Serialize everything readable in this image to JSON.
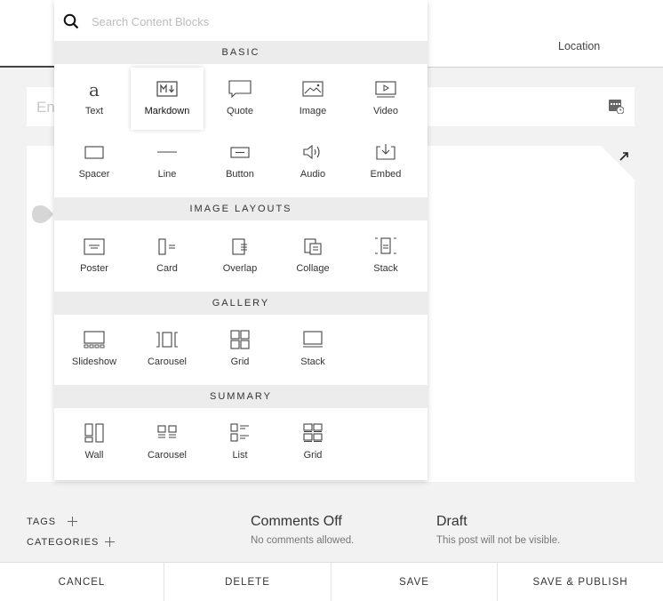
{
  "header": {
    "location_tab": "Location",
    "title_placeholder": "Ent"
  },
  "picker": {
    "search_placeholder": "Search Content Blocks",
    "sections": [
      {
        "title": "BASIC",
        "items": [
          {
            "label": "Text",
            "icon": "text-icon"
          },
          {
            "label": "Markdown",
            "icon": "markdown-icon",
            "selected": true
          },
          {
            "label": "Quote",
            "icon": "quote-icon"
          },
          {
            "label": "Image",
            "icon": "image-icon"
          },
          {
            "label": "Video",
            "icon": "video-icon"
          },
          {
            "label": "Spacer",
            "icon": "spacer-icon"
          },
          {
            "label": "Line",
            "icon": "line-icon"
          },
          {
            "label": "Button",
            "icon": "button-icon"
          },
          {
            "label": "Audio",
            "icon": "audio-icon"
          },
          {
            "label": "Embed",
            "icon": "embed-icon"
          }
        ]
      },
      {
        "title": "IMAGE LAYOUTS",
        "items": [
          {
            "label": "Poster",
            "icon": "poster-icon"
          },
          {
            "label": "Card",
            "icon": "card-icon"
          },
          {
            "label": "Overlap",
            "icon": "overlap-icon"
          },
          {
            "label": "Collage",
            "icon": "collage-icon"
          },
          {
            "label": "Stack",
            "icon": "stack-layout-icon"
          }
        ]
      },
      {
        "title": "GALLERY",
        "items": [
          {
            "label": "Slideshow",
            "icon": "slideshow-icon"
          },
          {
            "label": "Carousel",
            "icon": "carousel-icon"
          },
          {
            "label": "Grid",
            "icon": "grid-icon"
          },
          {
            "label": "Stack",
            "icon": "stack-gallery-icon"
          }
        ]
      },
      {
        "title": "SUMMARY",
        "items": [
          {
            "label": "Wall",
            "icon": "wall-icon"
          },
          {
            "label": "Carousel",
            "icon": "summary-carousel-icon"
          },
          {
            "label": "List",
            "icon": "list-icon"
          },
          {
            "label": "Grid",
            "icon": "summary-grid-icon"
          }
        ]
      }
    ]
  },
  "meta": {
    "tags_label": "TAGS",
    "categories_label": "CATEGORIES",
    "comments_title": "Comments Off",
    "comments_sub": "No comments allowed.",
    "status_title": "Draft",
    "status_sub": "This post will not be visible."
  },
  "footer": {
    "cancel": "CANCEL",
    "delete": "DELETE",
    "save": "SAVE",
    "save_publish": "SAVE & PUBLISH"
  },
  "colors": {
    "background": "#f2f2f2",
    "section_header": "#ececec",
    "add_button": "#dcdcdc"
  }
}
